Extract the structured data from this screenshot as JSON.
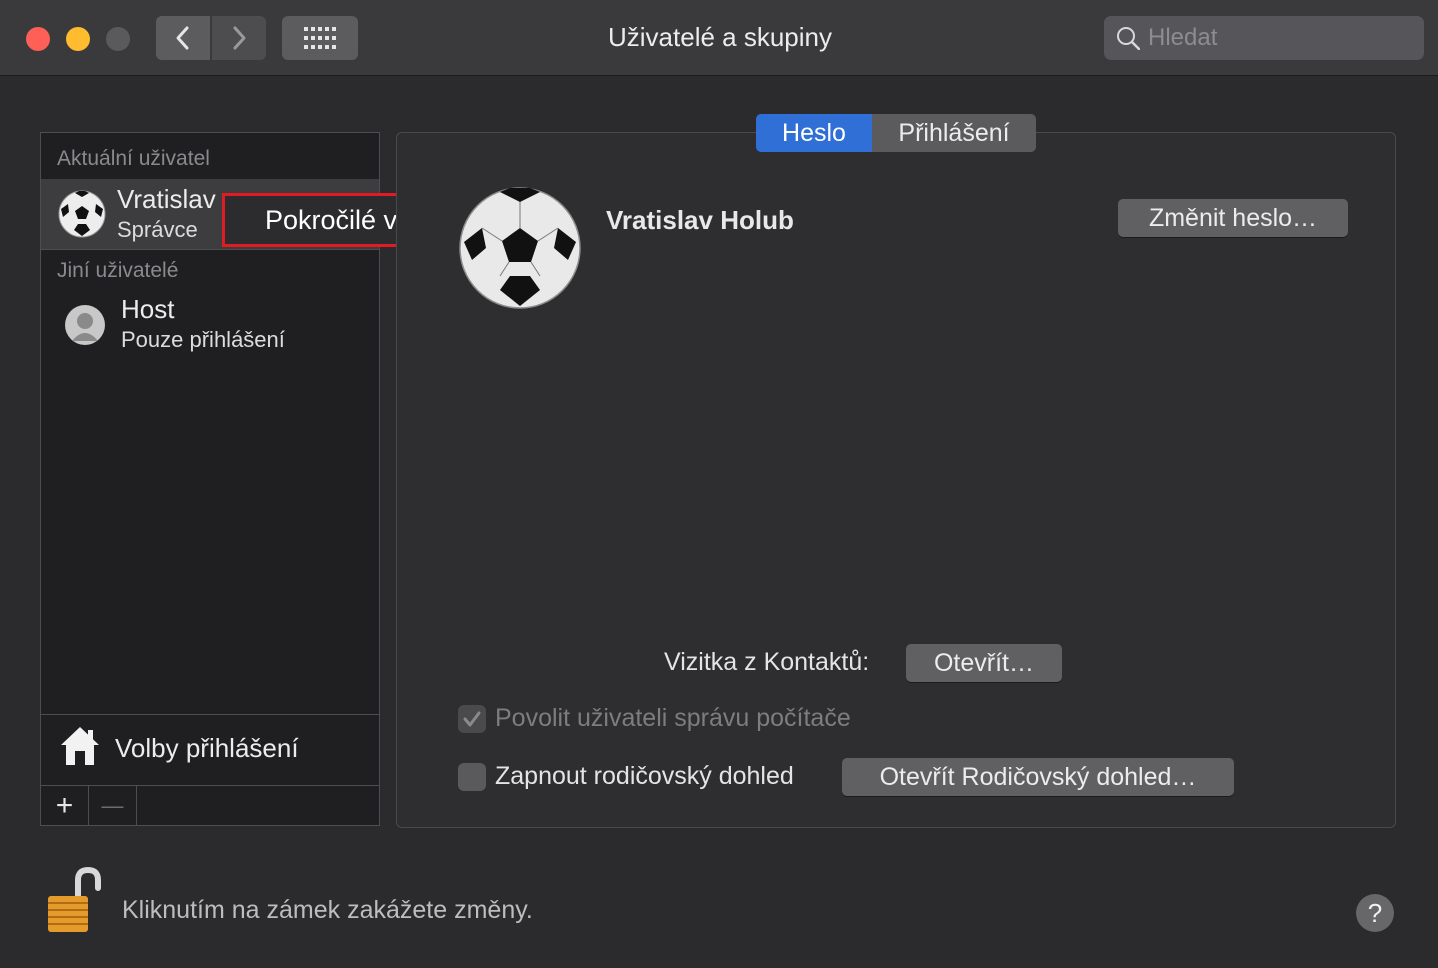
{
  "window": {
    "title": "Uživatelé a skupiny",
    "search_placeholder": "Hledat"
  },
  "sidebar": {
    "current_header": "Aktuální uživatel",
    "current_user": {
      "name": "Vratislav Holub",
      "name_visible": "Vratislav",
      "role": "Správce",
      "avatar": "soccer-ball"
    },
    "others_header": "Jiní uživatelé",
    "other_users": [
      {
        "name": "Host",
        "role": "Pouze přihlášení",
        "avatar": "generic-user"
      }
    ],
    "login_options_label": "Volby přihlášení",
    "add_symbol": "+",
    "remove_symbol": "—"
  },
  "context_menu": {
    "item": "Pokročilé volby…",
    "highlight_color": "#e01b24"
  },
  "tabs": [
    {
      "label": "Heslo",
      "active": true
    },
    {
      "label": "Přihlášení",
      "active": false
    }
  ],
  "account": {
    "name": "Vratislav Holub",
    "change_password_label": "Změnit heslo…",
    "contact_card_label": "Vizitka z Kontaktů:",
    "open_label": "Otevřít…",
    "allow_admin_label": "Povolit uživateli správu počítače",
    "allow_admin_checked": true,
    "allow_admin_enabled": false,
    "parental_label": "Zapnout rodičovský dohled",
    "parental_checked": false,
    "open_parental_label": "Otevřít Rodičovský dohled…"
  },
  "footer": {
    "lock_text": "Kliknutím na zámek zakážete změny.",
    "lock_state": "unlocked",
    "help_symbol": "?"
  },
  "colors": {
    "accent": "#2f6fd6",
    "background": "#2b2b2d"
  }
}
